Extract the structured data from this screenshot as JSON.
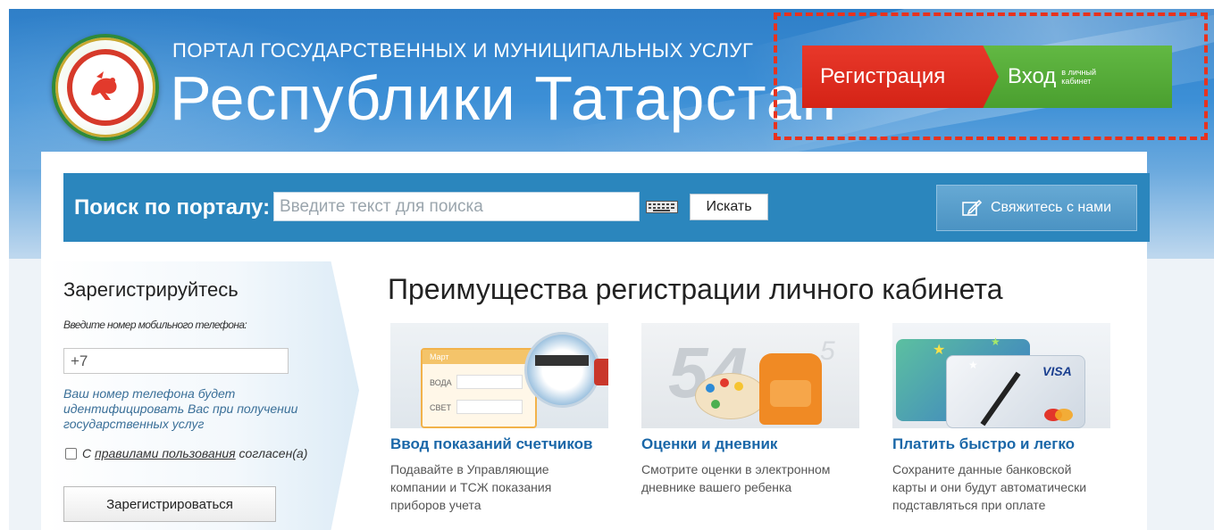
{
  "header": {
    "portal_line1": "ПОРТАЛ ГОСУДАРСТВЕННЫХ И МУНИЦИПАЛЬНЫХ УСЛУГ",
    "portal_line2": "Республики Татарстан",
    "register_label": "Регистрация",
    "login_label": "Вход",
    "login_sub": "в личный кабинет",
    "colors": {
      "register": "#d42316",
      "login": "#4a9f2f",
      "highlight_frame": "#e8321e",
      "header_blue": "#2f7fc8"
    }
  },
  "search": {
    "label": "Поиск по порталу:",
    "placeholder": "Введите текст для поиска",
    "button": "Искать",
    "contact_button": "Свяжитесь с нами"
  },
  "registration": {
    "title": "Зарегистрируйтесь",
    "hint": "Введите номер мобильного телефона:",
    "phone_value": "+7",
    "note": "Ваш номер телефона будет идентифицировать Вас при получении государственных услуг",
    "agree_prefix": "С ",
    "agree_link": "правилами пользования",
    "agree_suffix": " согласен(а)",
    "button": "Зарегистрироваться"
  },
  "advantages": {
    "title": "Преимущества регистрации личного кабинета",
    "items": [
      {
        "title": "Ввод показаний счетчиков",
        "desc": "Подавайте в Управляющие компании и ТСЖ показания приборов учета",
        "image_labels": {
          "month": "Март",
          "water": "ВОДА",
          "light": "СВЕТ"
        }
      },
      {
        "title": "Оценки и дневник",
        "desc": "Смотрите оценки в электронном дневнике вашего ребенка"
      },
      {
        "title": "Платить быстро и легко",
        "desc": "Сохраните данные банковской карты и они будут автоматически подставляться при оплате",
        "image_labels": {
          "card_brand": "VISA"
        }
      }
    ]
  }
}
